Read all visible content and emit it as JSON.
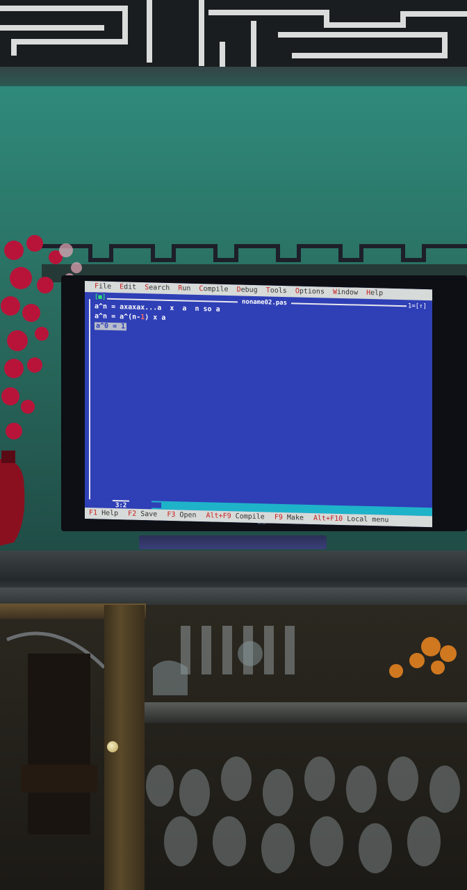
{
  "ide": {
    "menu": [
      "File",
      "Edit",
      "Search",
      "Run",
      "Compile",
      "Debug",
      "Tools",
      "Options",
      "Window",
      "Help"
    ],
    "window": {
      "close_box": "[■]",
      "filename": "noname02.pas",
      "window_number": "1=[↑]"
    },
    "editor_lines": {
      "line1": "a^n = axaxax...a  x  a  n so a",
      "line2_pre": "a^n = a^(n-",
      "line2_hl": "1",
      "line2_post": ") x a",
      "line3": "a^0 = 1"
    },
    "status": {
      "position": "3:2"
    },
    "hints": [
      {
        "key": "F1",
        "label": "Help"
      },
      {
        "key": "F2",
        "label": "Save"
      },
      {
        "key": "F3",
        "label": "Open"
      },
      {
        "key": "Alt+F9",
        "label": "Compile"
      },
      {
        "key": "F9",
        "label": "Make"
      },
      {
        "key": "Alt+F10",
        "label": "Local menu"
      }
    ]
  },
  "colors": {
    "screen_blue": "#2f3fb6",
    "menu_gray": "#d6dad8",
    "hotkey_red": "#c62020",
    "wall_teal": "#2f8a7c"
  }
}
